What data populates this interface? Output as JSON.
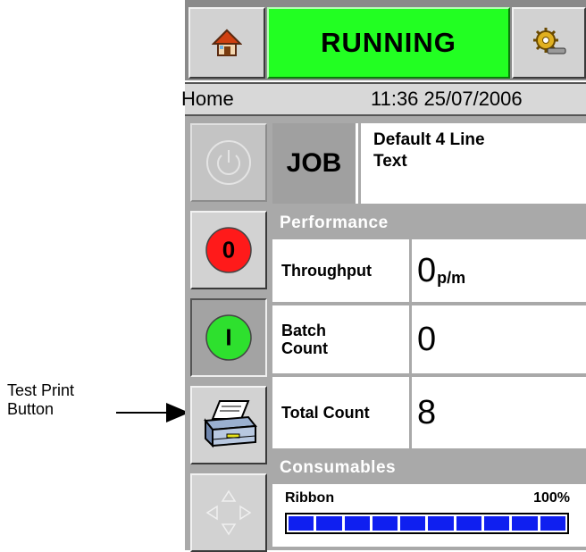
{
  "annotation": {
    "line1": "Test Print",
    "line2": "Button"
  },
  "status": {
    "label": "RUNNING"
  },
  "infobar": {
    "page": "Home",
    "datetime": "11:36 25/07/2006"
  },
  "side_buttons": [
    {
      "name": "power-button",
      "icon": "power-icon"
    },
    {
      "name": "stop-button",
      "label": "0",
      "color": "#ff1a1a"
    },
    {
      "name": "start-button",
      "label": "I",
      "color": "#2ee02e"
    },
    {
      "name": "test-print-button",
      "icon": "printer-icon"
    },
    {
      "name": "navigation-button",
      "icon": "arrows-icon"
    }
  ],
  "job": {
    "label": "JOB",
    "name_line1": "Default 4 Line",
    "name_line2": "Text"
  },
  "performance": {
    "heading": "Performance",
    "throughput": {
      "label": "Throughput",
      "value": "0",
      "unit": "p/m"
    },
    "batch": {
      "label_line1": "Batch",
      "label_line2": "Count",
      "value": "0"
    },
    "total": {
      "label": "Total Count",
      "value": "8"
    }
  },
  "consumables": {
    "heading": "Consumables",
    "ribbon_label": "Ribbon",
    "ribbon_percent": "100%",
    "ribbon_level": 1.0,
    "segments": 10
  },
  "colors": {
    "running": "#22ff22",
    "panel": "#a9a9a9",
    "bar": "#0f1ff0"
  }
}
